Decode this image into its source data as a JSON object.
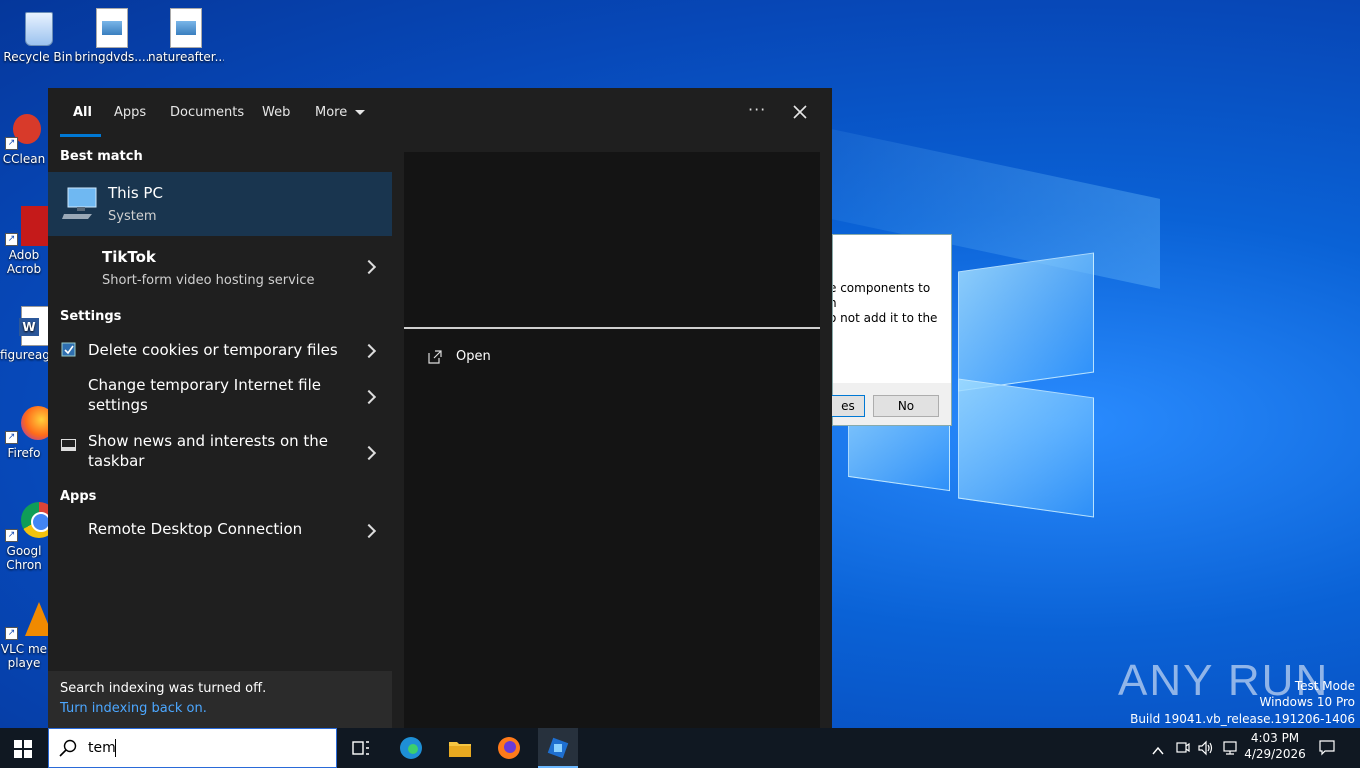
{
  "desktop": {
    "icons": [
      {
        "label": "Recycle Bin",
        "icon": "recycle-bin-icon"
      },
      {
        "label": "bringdvds....",
        "icon": "image-file-icon"
      },
      {
        "label": "natureafter...",
        "icon": "image-file-icon"
      },
      {
        "label": "CClean",
        "icon": "ccleaner-icon"
      },
      {
        "label": "Adob",
        "label2": "Acrob",
        "icon": "acrobat-icon"
      },
      {
        "label": "figureag",
        "icon": "word-doc-icon"
      },
      {
        "label": "Firefo",
        "icon": "firefox-icon"
      },
      {
        "label": "Googl",
        "label2": "Chron",
        "icon": "chrome-icon"
      },
      {
        "label": "VLC me",
        "label2": "playe",
        "icon": "vlc-icon"
      }
    ]
  },
  "dialog": {
    "lines": [
      "e components to",
      "n",
      "o not add it to the"
    ],
    "yes_label": "es",
    "no_label": "No"
  },
  "search_panel": {
    "tabs": [
      {
        "label": "All",
        "active": true
      },
      {
        "label": "Apps"
      },
      {
        "label": "Documents"
      },
      {
        "label": "Web"
      },
      {
        "label": "More"
      }
    ],
    "more_options_label": "···",
    "sections": {
      "best_match": "Best match",
      "settings": "Settings",
      "apps": "Apps"
    },
    "best_match": {
      "title": "This PC",
      "subtitle": "System"
    },
    "web_result": {
      "title": "TikTok",
      "subtitle": "Short-form video hosting service"
    },
    "settings_items": [
      {
        "title": "Delete cookies or temporary files"
      },
      {
        "title": "Change temporary Internet file",
        "title2": "settings"
      },
      {
        "title": "Show news and interests on the",
        "title2": "taskbar"
      }
    ],
    "apps_items": [
      {
        "title": "Remote Desktop Connection"
      }
    ],
    "preview": {
      "open_label": "Open"
    },
    "footer": {
      "message": "Search indexing was turned off.",
      "link": "Turn indexing back on."
    }
  },
  "taskbar": {
    "search_value": "tem",
    "clock_time": "4:03 PM",
    "clock_date": "4/29/2026"
  },
  "watermark": {
    "brand": "ANY RUN",
    "line1": "Test Mode",
    "line2": "Windows 10 Pro",
    "line3": "Build 19041.vb_release.191206-1406"
  },
  "colors": {
    "accent": "#0078d4",
    "panel_bg": "#1f1f1f",
    "selected_bg": "#19354f",
    "taskbar_bg": "#101822"
  }
}
